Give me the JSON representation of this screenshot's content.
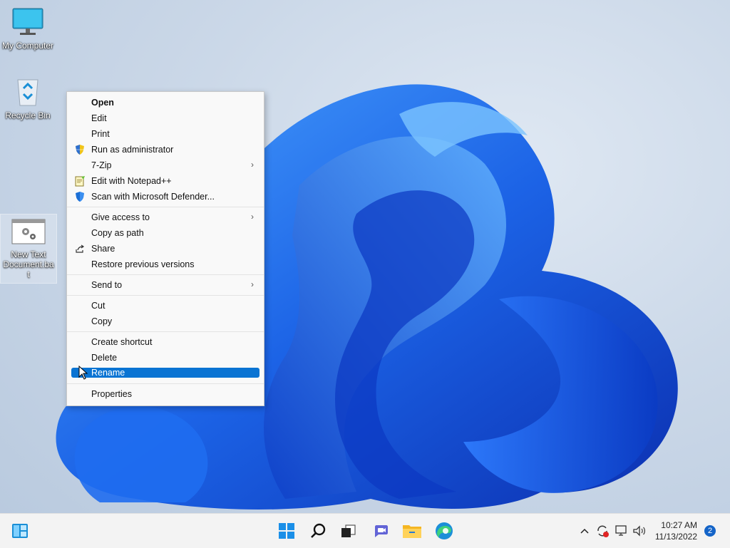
{
  "desktop": {
    "icons": [
      {
        "label": "My Computer"
      },
      {
        "label": "Recycle Bin"
      },
      {
        "label_line1": "New Text",
        "label_line2": "Document.ba",
        "label_line3": "t"
      }
    ]
  },
  "context_menu": {
    "items": [
      {
        "label": "Open",
        "bold": true
      },
      {
        "label": "Edit"
      },
      {
        "label": "Print"
      },
      {
        "label": "Run as administrator",
        "icon": "shield-icon"
      },
      {
        "label": "7-Zip",
        "submenu": true
      },
      {
        "label": "Edit with Notepad++",
        "icon": "notepad-plus-plus-icon"
      },
      {
        "label": "Scan with Microsoft Defender...",
        "icon": "defender-icon"
      },
      {
        "label": "Give access to",
        "submenu": true
      },
      {
        "label": "Copy as path"
      },
      {
        "label": "Share",
        "icon": "share-icon"
      },
      {
        "label": "Restore previous versions"
      },
      {
        "label": "Send to",
        "submenu": true
      },
      {
        "label": "Cut"
      },
      {
        "label": "Copy"
      },
      {
        "label": "Create shortcut"
      },
      {
        "label": "Delete"
      },
      {
        "label": "Rename",
        "highlighted": true
      },
      {
        "label": "Properties"
      }
    ]
  },
  "taskbar": {
    "widgets_icon": "widgets-icon",
    "apps": [
      "start-icon",
      "search-icon",
      "task-view-icon",
      "teams-chat-icon",
      "file-explorer-icon",
      "edge-icon"
    ],
    "tray": [
      "chevron-up-icon",
      "update-icon",
      "network-icon",
      "volume-icon"
    ],
    "time": "10:27 AM",
    "date": "11/13/2022",
    "notification_count": "2"
  },
  "colors": {
    "accent": "#0a74d3",
    "menu_bg": "#f9f9f9",
    "taskbar_bg": "#f3f3f3"
  }
}
